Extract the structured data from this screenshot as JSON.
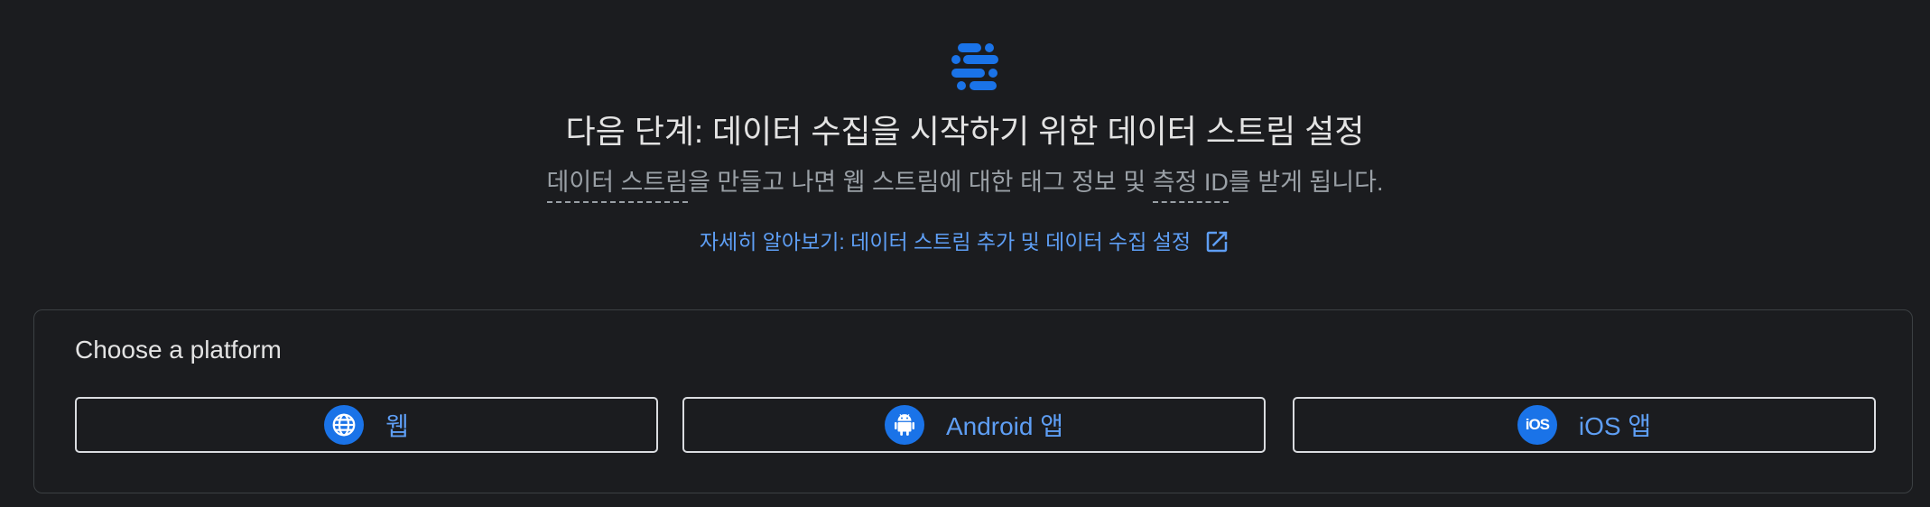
{
  "header": {
    "icon": "data-stream-icon",
    "title": "다음 단계: 데이터 수집을 시작하기 위한 데이터 스트림 설정",
    "subtitle": {
      "term1": "데이터 스트림",
      "part1": "을 만들고 나면 웹 스트림에 대한 태그 정보 및 ",
      "term2": "측정 ID",
      "part2": "를 받게 됩니다."
    },
    "learn_more": "자세히 알아보기: 데이터 스트림 추가 및 데이터 수집 설정"
  },
  "platform": {
    "heading": "Choose a platform",
    "options": [
      {
        "label": "웹",
        "icon": "globe-icon"
      },
      {
        "label": "Android 앱",
        "icon": "android-icon"
      },
      {
        "label": "iOS 앱",
        "icon": "ios-icon"
      }
    ]
  },
  "colors": {
    "background": "#1b1c1f",
    "accent": "#1a73e8",
    "link": "#5e9ef4",
    "text": "#e3e3e3",
    "muted": "#9aa0a6",
    "border": "#3c4043"
  }
}
